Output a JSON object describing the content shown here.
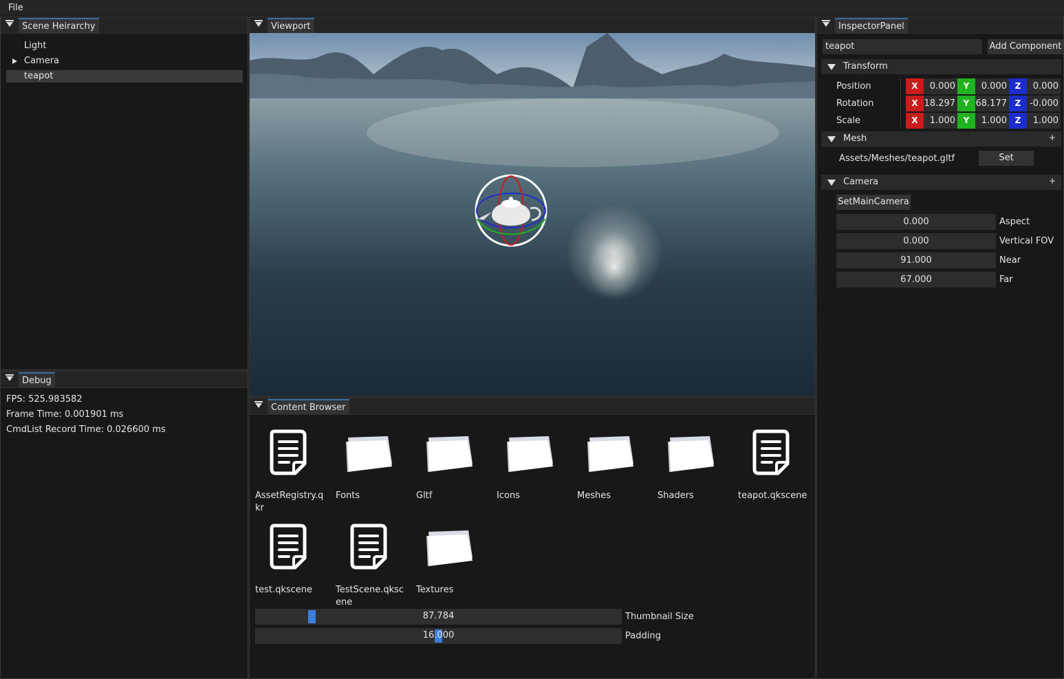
{
  "menu": {
    "file": "File"
  },
  "hierarchy": {
    "tab": "Scene Heirarchy",
    "items": [
      {
        "label": "Light"
      },
      {
        "label": "Camera"
      },
      {
        "label": "teapot"
      }
    ]
  },
  "debug": {
    "tab": "Debug",
    "fps": "FPS: 525.983582",
    "frame_time": "Frame Time: 0.001901 ms",
    "cmdlist": "CmdList Record Time: 0.026600 ms"
  },
  "viewport": {
    "tab": "Viewport"
  },
  "content_browser": {
    "tab": "Content Browser",
    "items": [
      {
        "label": "AssetRegistry.qkr",
        "icon": "file-icon"
      },
      {
        "label": "Fonts",
        "icon": "folder-icon"
      },
      {
        "label": "Gltf",
        "icon": "folder-icon"
      },
      {
        "label": "Icons",
        "icon": "folder-icon"
      },
      {
        "label": "Meshes",
        "icon": "folder-icon"
      },
      {
        "label": "Shaders",
        "icon": "folder-icon"
      },
      {
        "label": "teapot.qkscene",
        "icon": "file-icon"
      },
      {
        "label": "test.qkscene",
        "icon": "file-icon"
      },
      {
        "label": "TestScene.qkscene",
        "icon": "file-icon"
      },
      {
        "label": "Textures",
        "icon": "folder-icon"
      }
    ],
    "thumbnail_size": {
      "value": "87.784",
      "label": "Thumbnail Size"
    },
    "padding": {
      "value": "16.000",
      "label": "Padding"
    }
  },
  "inspector": {
    "tab": "InspectorPanel",
    "name": "teapot",
    "add_component": "Add Component",
    "transform": {
      "title": "Transform",
      "rows": [
        {
          "label": "Position",
          "x": "0.000",
          "y": "0.000",
          "z": "0.000"
        },
        {
          "label": "Rotation",
          "x": "18.297",
          "y": "68.177",
          "z": "-0.000"
        },
        {
          "label": "Scale",
          "x": "1.000",
          "y": "1.000",
          "z": "1.000"
        }
      ],
      "axis_x": "X",
      "axis_y": "Y",
      "axis_z": "Z"
    },
    "mesh": {
      "title": "Mesh",
      "path": "Assets/Meshes/teapot.gltf",
      "set": "Set",
      "plus": "+"
    },
    "camera": {
      "title": "Camera",
      "plus": "+",
      "set_main": "SetMainCamera",
      "fields": [
        {
          "value": "0.000",
          "label": "Aspect"
        },
        {
          "value": "0.000",
          "label": "Vertical FOV"
        },
        {
          "value": "91.000",
          "label": "Near"
        },
        {
          "value": "67.000",
          "label": "Far"
        }
      ]
    }
  },
  "colors": {
    "axis_x": "#cc1b1b",
    "axis_y": "#1fb41f",
    "axis_z": "#1d2ccc",
    "accent": "#3d7ddb"
  }
}
